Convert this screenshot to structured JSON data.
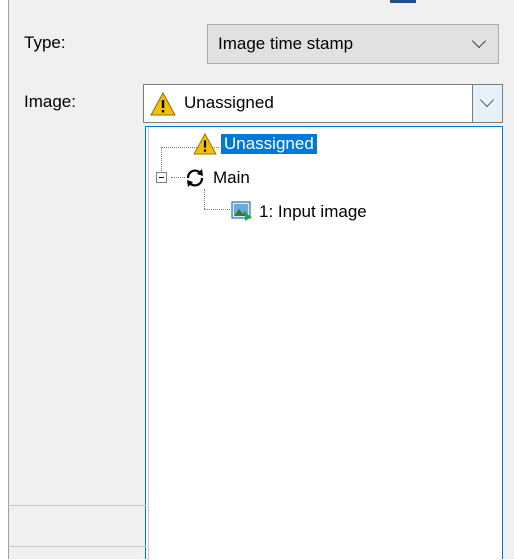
{
  "form": {
    "type_label": "Type:",
    "image_label": "Image:",
    "type_value": "Image time stamp",
    "image_value": "Unassigned"
  },
  "tree": {
    "items": [
      {
        "label": "Unassigned",
        "icon": "warning-icon",
        "selected": true
      },
      {
        "label": "Main",
        "icon": "cycle-icon",
        "expanded": true
      },
      {
        "label": "1: Input image",
        "icon": "image-icon"
      }
    ]
  },
  "colors": {
    "selection": "#0078d7",
    "dialog_bg": "#f0f0f0",
    "warning": "#f2c200"
  }
}
